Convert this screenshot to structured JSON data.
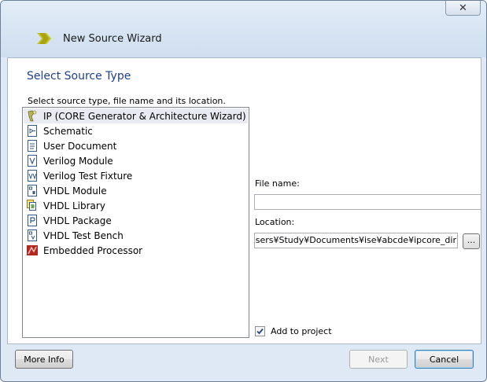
{
  "window": {
    "title": "New Source Wizard",
    "close_label": "✕"
  },
  "page": {
    "section_title": "Select Source Type",
    "instruction": "Select source type, file name and its location."
  },
  "source_types": [
    {
      "label": "IP (CORE Generator & Architecture Wizard)",
      "icon": "ip-core-icon",
      "selected": true
    },
    {
      "label": "Schematic",
      "icon": "schematic-icon"
    },
    {
      "label": "User Document",
      "icon": "document-icon"
    },
    {
      "label": "Verilog Module",
      "icon": "verilog-module-icon"
    },
    {
      "label": "Verilog Test Fixture",
      "icon": "verilog-test-fixture-icon"
    },
    {
      "label": "VHDL Module",
      "icon": "vhdl-module-icon"
    },
    {
      "label": "VHDL Library",
      "icon": "vhdl-library-icon"
    },
    {
      "label": "VHDL Package",
      "icon": "vhdl-package-icon"
    },
    {
      "label": "VHDL Test Bench",
      "icon": "vhdl-test-bench-icon"
    },
    {
      "label": "Embedded Processor",
      "icon": "embedded-processor-icon"
    }
  ],
  "form": {
    "file_name_label": "File name:",
    "file_name_value": "",
    "location_label": "Location:",
    "location_value": "C:¥Users¥Study¥Documents¥ise¥abcde¥ipcore_dir",
    "browse_label": "...",
    "add_to_project_label": "Add to project",
    "add_to_project_checked": true
  },
  "buttons": {
    "more_info": "More Info",
    "next": "Next",
    "cancel": "Cancel"
  },
  "colors": {
    "accent_title": "#1e3f8a",
    "window_frame": "#dfe9f5"
  }
}
